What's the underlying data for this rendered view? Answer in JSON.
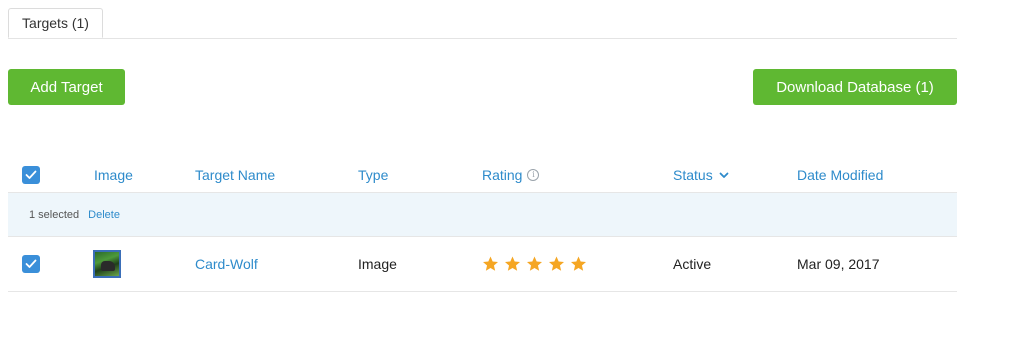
{
  "tabs": [
    {
      "label": "Targets (1)"
    }
  ],
  "toolbar": {
    "add_label": "Add Target",
    "download_label": "Download Database (1)"
  },
  "colors": {
    "accent_green": "#5fb832",
    "link_blue": "#2e8bcb",
    "checkbox_blue": "#3a8fd9",
    "star_orange": "#f5a623",
    "selection_bg": "#eef6fb"
  },
  "table": {
    "headers": {
      "image": "Image",
      "target_name": "Target Name",
      "type": "Type",
      "rating": "Rating",
      "status": "Status",
      "date_modified": "Date Modified"
    },
    "selection": {
      "count_text": "1 selected",
      "delete_label": "Delete"
    },
    "rows": [
      {
        "checked": true,
        "image_icon": "wolf-thumbnail",
        "name": "Card-Wolf",
        "type": "Image",
        "rating": 5,
        "rating_max": 5,
        "status": "Active",
        "date": "Mar 09, 2017"
      }
    ]
  }
}
